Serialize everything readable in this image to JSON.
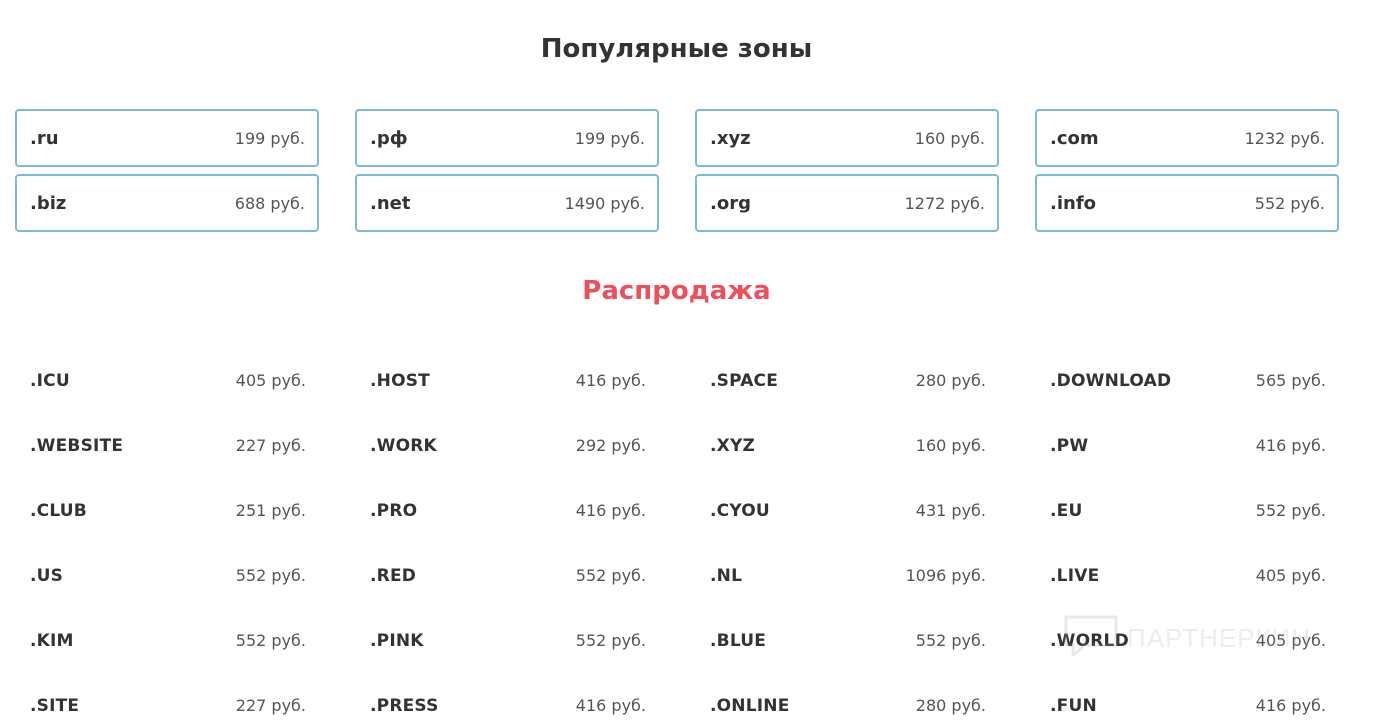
{
  "popular": {
    "title": "Популярные зоны",
    "zones": [
      {
        "name": ".ru",
        "price": "199 руб."
      },
      {
        "name": ".рф",
        "price": "199 руб."
      },
      {
        "name": ".xyz",
        "price": "160 руб."
      },
      {
        "name": ".com",
        "price": "1232 руб."
      },
      {
        "name": ".biz",
        "price": "688 руб."
      },
      {
        "name": ".net",
        "price": "1490 руб."
      },
      {
        "name": ".org",
        "price": "1272 руб."
      },
      {
        "name": ".info",
        "price": "552 руб."
      }
    ]
  },
  "sale": {
    "title": "Распродажа",
    "title_color": "#ef4f5a",
    "items": [
      {
        "name": ".ICU",
        "price": "405 руб."
      },
      {
        "name": ".HOST",
        "price": "416 руб."
      },
      {
        "name": ".SPACE",
        "price": "280 руб."
      },
      {
        "name": ".DOWNLOAD",
        "price": "565 руб."
      },
      {
        "name": ".WEBSITE",
        "price": "227 руб."
      },
      {
        "name": ".WORK",
        "price": "292 руб."
      },
      {
        "name": ".XYZ",
        "price": "160 руб."
      },
      {
        "name": ".PW",
        "price": "416 руб."
      },
      {
        "name": ".CLUB",
        "price": "251 руб."
      },
      {
        "name": ".PRO",
        "price": "416 руб."
      },
      {
        "name": ".CYOU",
        "price": "431 руб."
      },
      {
        "name": ".EU",
        "price": "552 руб."
      },
      {
        "name": ".US",
        "price": "552 руб."
      },
      {
        "name": ".RED",
        "price": "552 руб."
      },
      {
        "name": ".NL",
        "price": "1096 руб."
      },
      {
        "name": ".LIVE",
        "price": "405 руб."
      },
      {
        "name": ".KIM",
        "price": "552 руб."
      },
      {
        "name": ".PINK",
        "price": "552 руб."
      },
      {
        "name": ".BLUE",
        "price": "552 руб."
      },
      {
        "name": ".WORLD",
        "price": "405 руб."
      },
      {
        "name": ".SITE",
        "price": "227 руб."
      },
      {
        "name": ".PRESS",
        "price": "416 руб."
      },
      {
        "name": ".ONLINE",
        "price": "280 руб."
      },
      {
        "name": ".FUN",
        "price": "416 руб."
      }
    ]
  },
  "watermark": {
    "text": "ПАРТНЕРКИН",
    "icon": "chat-bubble-icon"
  },
  "colors": {
    "card_border": "#7cbad8",
    "text": "#333333",
    "price": "#555555"
  }
}
